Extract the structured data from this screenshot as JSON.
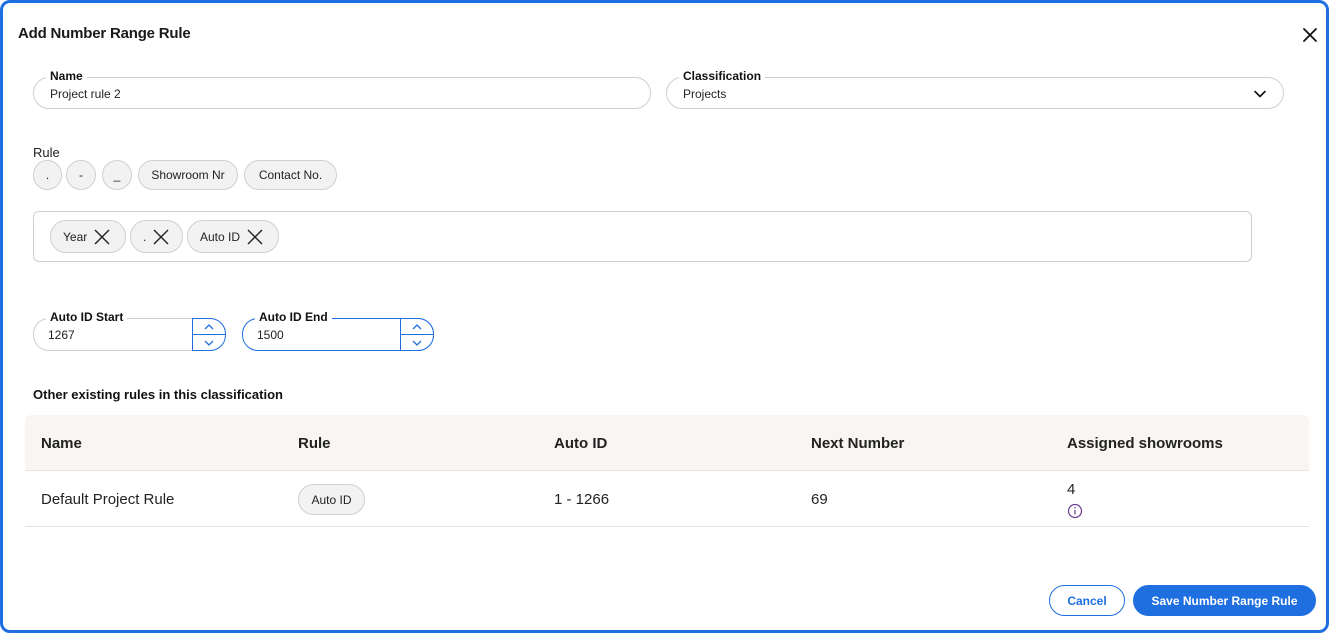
{
  "dialog": {
    "title": "Add Number Range Rule"
  },
  "fields": {
    "name": {
      "label": "Name",
      "value": "Project rule 2"
    },
    "classification": {
      "label": "Classification",
      "value": "Projects"
    }
  },
  "rule": {
    "label": "Rule",
    "chips": [
      ".",
      "-",
      "_",
      "Showroom Nr",
      "Contact No."
    ],
    "selected": [
      "Year",
      ".",
      "Auto ID"
    ]
  },
  "auto_id": {
    "start": {
      "label": "Auto ID Start",
      "value": "1267"
    },
    "end": {
      "label": "Auto ID End",
      "value": "1500"
    }
  },
  "existing": {
    "title": "Other existing rules in this classification",
    "columns": [
      "Name",
      "Rule",
      "Auto ID",
      "Next Number",
      "Assigned showrooms"
    ],
    "rows": [
      {
        "name": "Default Project Rule",
        "rule": "Auto ID",
        "auto_id": "1 - 1266",
        "next_number": "69",
        "assigned": "4"
      }
    ]
  },
  "actions": {
    "cancel": "Cancel",
    "save": "Save Number Range Rule"
  },
  "colors": {
    "accent": "#1f6fe0",
    "header_bg": "#f8f5f2",
    "chip_bg": "#f2f2f2",
    "info_icon": "#6a3d8f"
  }
}
